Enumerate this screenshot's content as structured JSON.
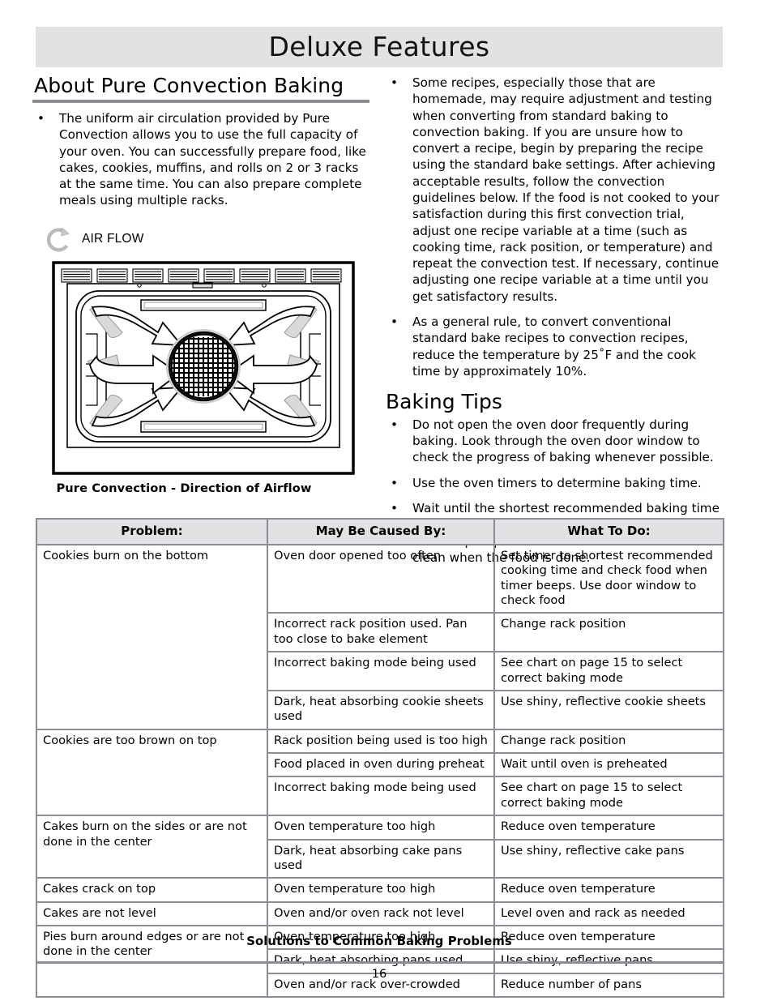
{
  "page": {
    "header_title": "Deluxe Features",
    "page_number": "16"
  },
  "left_column": {
    "heading": "About Pure Convection Baking",
    "bullets": [
      "The uniform air circulation provided by Pure Convection allows you to use the full capacity of your oven. You can successfully prepare food, like cakes, cookies, muffins, and rolls on 2 or 3 racks at the same time. You can also prepare complete meals using multiple racks."
    ],
    "airflow_label": "AIR FLOW",
    "figure_caption": "Pure Convection - Direction of Airflow"
  },
  "right_column": {
    "intro_bullets": [
      "Some recipes, especially those that are homemade, may require adjustment and testing when converting from standard baking to convection baking. If you are unsure how to convert a recipe, begin by preparing the recipe using the standard bake settings. After achieving acceptable results, follow the convection guidelines below. If the food is not cooked to your satisfaction during this first convection trial, adjust one recipe variable at a time (such as cooking time, rack position, or temperature) and repeat the convection test. If necessary, continue adjusting one recipe variable at a time until you get satisfactory results.",
      "As a general rule, to convert conventional standard bake recipes to convection recipes, reduce the temperature by 25˚F and the cook time by approximately 10%."
    ],
    "baking_tips_heading": "Baking Tips",
    "baking_tips": [
      "Do not open the oven door frequently during baking. Look through the oven door window to check the progress of baking whenever possible.",
      "Use the oven timers to determine baking time.",
      "Wait until the shortest recommended baking time before checking food. For most baked goods, a wooden pick placed in the center should come clean when the food is done."
    ]
  },
  "table": {
    "caption": "Solutions to Common Baking Problems",
    "headers": [
      "Problem:",
      "May Be Caused By:",
      "What To Do:"
    ],
    "rows": [
      {
        "problem": "Cookies burn on the bottom",
        "problem_rowspan": 4,
        "cause": "Oven door opened too often",
        "action": "Set timer to shortest recommended cooking time and check food when timer beeps. Use door window to check food"
      },
      {
        "cause": "Incorrect rack position used. Pan too close to bake element",
        "action": "Change rack position"
      },
      {
        "cause": "Incorrect baking mode being used",
        "action": "See chart on page 15 to select correct baking mode"
      },
      {
        "cause": "Dark, heat absorbing cookie sheets used",
        "action": "Use shiny, reflective cookie sheets"
      },
      {
        "problem": "Cookies are too brown on top",
        "problem_rowspan": 3,
        "cause": "Rack position being used is too high",
        "action": "Change rack position"
      },
      {
        "cause": "Food placed in oven during preheat",
        "action": "Wait until oven is preheated"
      },
      {
        "cause": "Incorrect baking mode being used",
        "action": "See chart on page 15 to select correct baking mode"
      },
      {
        "problem": "Cakes burn on the sides or are not done in the center",
        "problem_rowspan": 2,
        "cause": "Oven temperature too high",
        "action": "Reduce oven temperature"
      },
      {
        "cause": "Dark, heat absorbing cake pans used",
        "action": "Use shiny, reflective cake pans"
      },
      {
        "problem": "Cakes crack on top",
        "problem_rowspan": 1,
        "cause": "Oven temperature too high",
        "action": "Reduce oven temperature"
      },
      {
        "problem": "Cakes are not level",
        "problem_rowspan": 1,
        "cause": "Oven and/or oven rack not level",
        "action": "Level oven and rack as needed"
      },
      {
        "problem": "Pies burn around edges or are not done in the center",
        "problem_rowspan": 3,
        "cause": "Oven temperature too high",
        "action": "Reduce oven temperature"
      },
      {
        "cause": "Dark, heat absorbing pans used",
        "action": "Use shiny, reflective pans"
      },
      {
        "cause": "Oven and/or rack over-crowded",
        "action": "Reduce number of pans"
      }
    ]
  },
  "icons": {
    "airflow": "circular-arrow-icon",
    "oven_fan": "mesh-fan-icon"
  },
  "colors": {
    "header_band": "#e2e2e4",
    "rule_gray": "#8c8c94",
    "table_border": "#8c8c94",
    "arrow_tail_gray": "#d9d9d9"
  }
}
